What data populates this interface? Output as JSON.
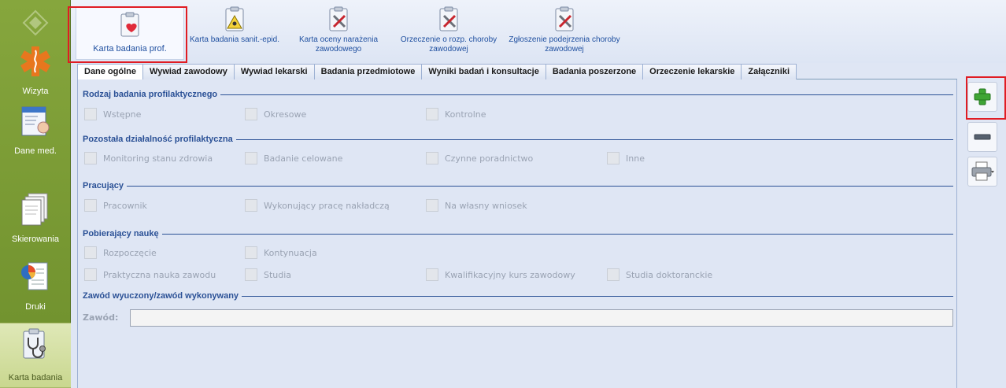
{
  "sidebar": {
    "items": [
      {
        "label": "Wizyta",
        "icon": "medical-star-icon"
      },
      {
        "label": "Dane med.",
        "icon": "patient-record-icon"
      },
      {
        "label": "Skierowania",
        "icon": "documents-icon"
      },
      {
        "label": "Druki",
        "icon": "report-chart-icon"
      },
      {
        "label": "Karta badania",
        "icon": "stethoscope-clipboard-icon"
      }
    ]
  },
  "toolbar": {
    "buttons": [
      {
        "label": "Karta badania prof.",
        "icon": "clipboard-heart-icon"
      },
      {
        "label": "Karta badania sanit.-epid.",
        "icon": "clipboard-hazard-icon"
      },
      {
        "label": "Karta oceny narażenia zawodowego",
        "icon": "clipboard-tools-icon"
      },
      {
        "label": "Orzeczenie o rozp. choroby zawodowej",
        "icon": "clipboard-tools-icon"
      },
      {
        "label": "Zgłoszenie podejrzenia choroby zawodowej",
        "icon": "clipboard-tools-icon"
      }
    ]
  },
  "tabs": [
    "Dane ogólne",
    "Wywiad zawodowy",
    "Wywiad lekarski",
    "Badania przedmiotowe",
    "Wyniki badań i konsultacje",
    "Badania poszerzone",
    "Orzeczenie lekarskie",
    "Załączniki"
  ],
  "sections": {
    "rodzaj": {
      "title": "Rodzaj badania profilaktycznego",
      "options": [
        "Wstępne",
        "Okresowe",
        "Kontrolne"
      ]
    },
    "pozostala": {
      "title": "Pozostała działalność profilaktyczna",
      "options": [
        "Monitoring stanu zdrowia",
        "Badanie celowane",
        "Czynne poradnictwo",
        "Inne"
      ]
    },
    "pracujacy": {
      "title": "Pracujący",
      "options": [
        "Pracownik",
        "Wykonujący pracę nakładczą",
        "Na własny wniosek"
      ]
    },
    "pobierajacy": {
      "title": "Pobierający naukę",
      "options": [
        "Rozpoczęcie",
        "Kontynuacja",
        "Praktyczna nauka zawodu",
        "Studia",
        "Kwalifikacyjny kurs zawodowy",
        "Studia doktoranckie"
      ]
    },
    "zawod": {
      "title": "Zawód wyuczony/zawód wykonywany",
      "field_label": "Zawód:",
      "field_value": ""
    }
  },
  "right_toolbar": {
    "buttons": [
      {
        "icon": "plus-icon"
      },
      {
        "icon": "minus-icon"
      },
      {
        "icon": "print-icon"
      }
    ]
  },
  "colors": {
    "accent": "#2b5196",
    "highlight": "#e01c23",
    "sidebar": "#7a9a33",
    "add": "#3fa535"
  }
}
